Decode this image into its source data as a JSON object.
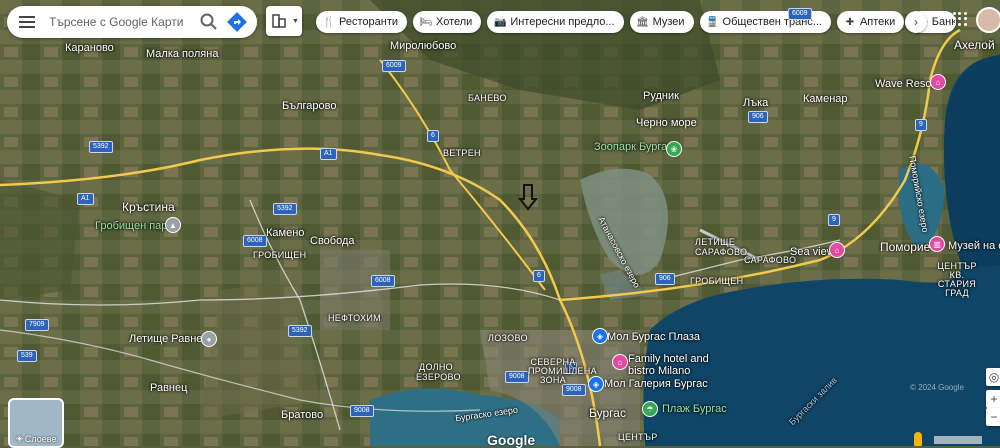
{
  "search": {
    "placeholder": "Търсене с Google Карти"
  },
  "chips": [
    {
      "icon": "restaurant-icon",
      "label": "Ресторанти"
    },
    {
      "icon": "hotel-icon",
      "label": "Хотели"
    },
    {
      "icon": "camera-icon",
      "label": "Интересни предло..."
    },
    {
      "icon": "museum-icon",
      "label": "Музеи"
    },
    {
      "icon": "transit-icon",
      "label": "Обществен транс..."
    },
    {
      "icon": "pharmacy-icon",
      "label": "Аптеки"
    },
    {
      "icon": "more-icon",
      "label": "Банк"
    }
  ],
  "places": {
    "karanovo": "Караново",
    "malka_polyana": "Малка поляна",
    "miroljubovo": "Миролюбово",
    "balgarovo": "Българово",
    "banevo": "БАНЕВО",
    "rudnik": "Рудник",
    "lyaka": "Лъка",
    "kamenar": "Каменар",
    "aheloy": "Ахелой",
    "wave_resort": "Wave Resort",
    "cherno_more": "Черно море",
    "zoo": "Зоопарк Бургас",
    "vetren": "ВЕТРЕН",
    "krastina": "Кръстина",
    "grave_park": "Гробищен парк",
    "kameno": "Камено",
    "svoboda": "Свобода",
    "grobishten": "ГРОБИЩЕН",
    "grobishten2": "ГРОБИЩЕН",
    "atanasovsko": "Атанасовско езеро",
    "letishte_sarafovo": "ЛЕТИЩЕ САРАФОВО",
    "sarafovo": "САРАФОВО",
    "pomoriysko": "Поморийско езеро",
    "pomorie": "Поморие",
    "sea_view": "Sea view",
    "museum_sol": "Музей на со",
    "staria_grad": "ЦЕНТЪР КВ. СТАРИЯ ГРАД",
    "neftohim": "НЕФТОХИМ",
    "letishte_ravnets": "Летище Равнец",
    "ravnets": "Равнец",
    "lozovo": "ЛОЗОВО",
    "dolno_ezerovo": "ДОЛНО ЕЗЕРОВО",
    "severna_zona": "СЕВЕРНА ПРОМИШЛЕНА ЗОНА",
    "mall_plaza": "Мол Бургас Плаза",
    "family_hotel": "Family hotel and",
    "family_hotel2": "bistro Milano",
    "mall_galeria": "Мол Галерия Бургас",
    "beach": "Плаж Бургас",
    "bratovo": "Братово",
    "burgasko": "Бургаско езеро",
    "burgas": "Бургас",
    "centar": "ЦЕНТЪР",
    "bay": "Бургаски залив"
  },
  "roads": {
    "a1": "A1",
    "a1b": "A1",
    "r6": "6",
    "r6b": "6",
    "r6c": "6",
    "r9": "9",
    "r9b": "9",
    "r5392": "5392",
    "r5392b": "5392",
    "r5392c": "5392",
    "r6008": "6008",
    "r6008b": "6008",
    "r6009": "6009",
    "r6009b": "6009",
    "r906": "906",
    "r906b": "906",
    "r7909": "7909",
    "r539": "539",
    "r9008": "9008",
    "r9008b": "9008",
    "r9008c": "9008"
  },
  "layers": {
    "label": "Слоеве"
  },
  "branding": {
    "google": "Google",
    "copyright": "© 2024 Google"
  }
}
